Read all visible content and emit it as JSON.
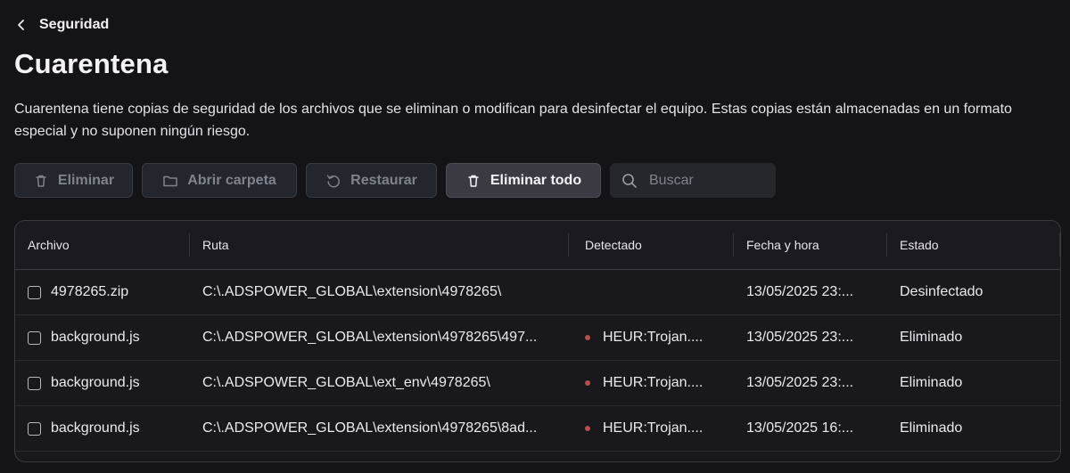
{
  "nav": {
    "back_label": "Seguridad",
    "back_icon": "chevron-left-icon"
  },
  "page": {
    "title": "Cuarentena",
    "description": "Cuarentena tiene copias de seguridad de los archivos que se eliminan o modifican para desinfectar el equipo. Estas copias están almacenadas en un formato especial y no suponen ningún riesgo."
  },
  "toolbar": {
    "delete_label": "Eliminar",
    "open_folder_label": "Abrir carpeta",
    "restore_label": "Restaurar",
    "delete_all_label": "Eliminar todo",
    "search_placeholder": "Buscar"
  },
  "table": {
    "columns": [
      "Archivo",
      "Ruta",
      "Detectado",
      "Fecha y hora",
      "Estado"
    ],
    "rows": [
      {
        "file": "4978265.zip",
        "path": "C:\\.ADSPOWER_GLOBAL\\extension\\4978265\\",
        "detected": "",
        "date": "13/05/2025 23:...",
        "status": "Desinfectado"
      },
      {
        "file": "background.js",
        "path": "C:\\.ADSPOWER_GLOBAL\\extension\\4978265\\497...",
        "detected": "HEUR:Trojan....",
        "date": "13/05/2025 23:...",
        "status": "Eliminado"
      },
      {
        "file": "background.js",
        "path": "C:\\.ADSPOWER_GLOBAL\\ext_env\\4978265\\",
        "detected": "HEUR:Trojan....",
        "date": "13/05/2025 23:...",
        "status": "Eliminado"
      },
      {
        "file": "background.js",
        "path": "C:\\.ADSPOWER_GLOBAL\\extension\\4978265\\8ad...",
        "detected": "HEUR:Trojan....",
        "date": "13/05/2025 16:...",
        "status": "Eliminado"
      }
    ]
  },
  "colors": {
    "background": "#141318",
    "threat_dot": "#B4514A"
  }
}
